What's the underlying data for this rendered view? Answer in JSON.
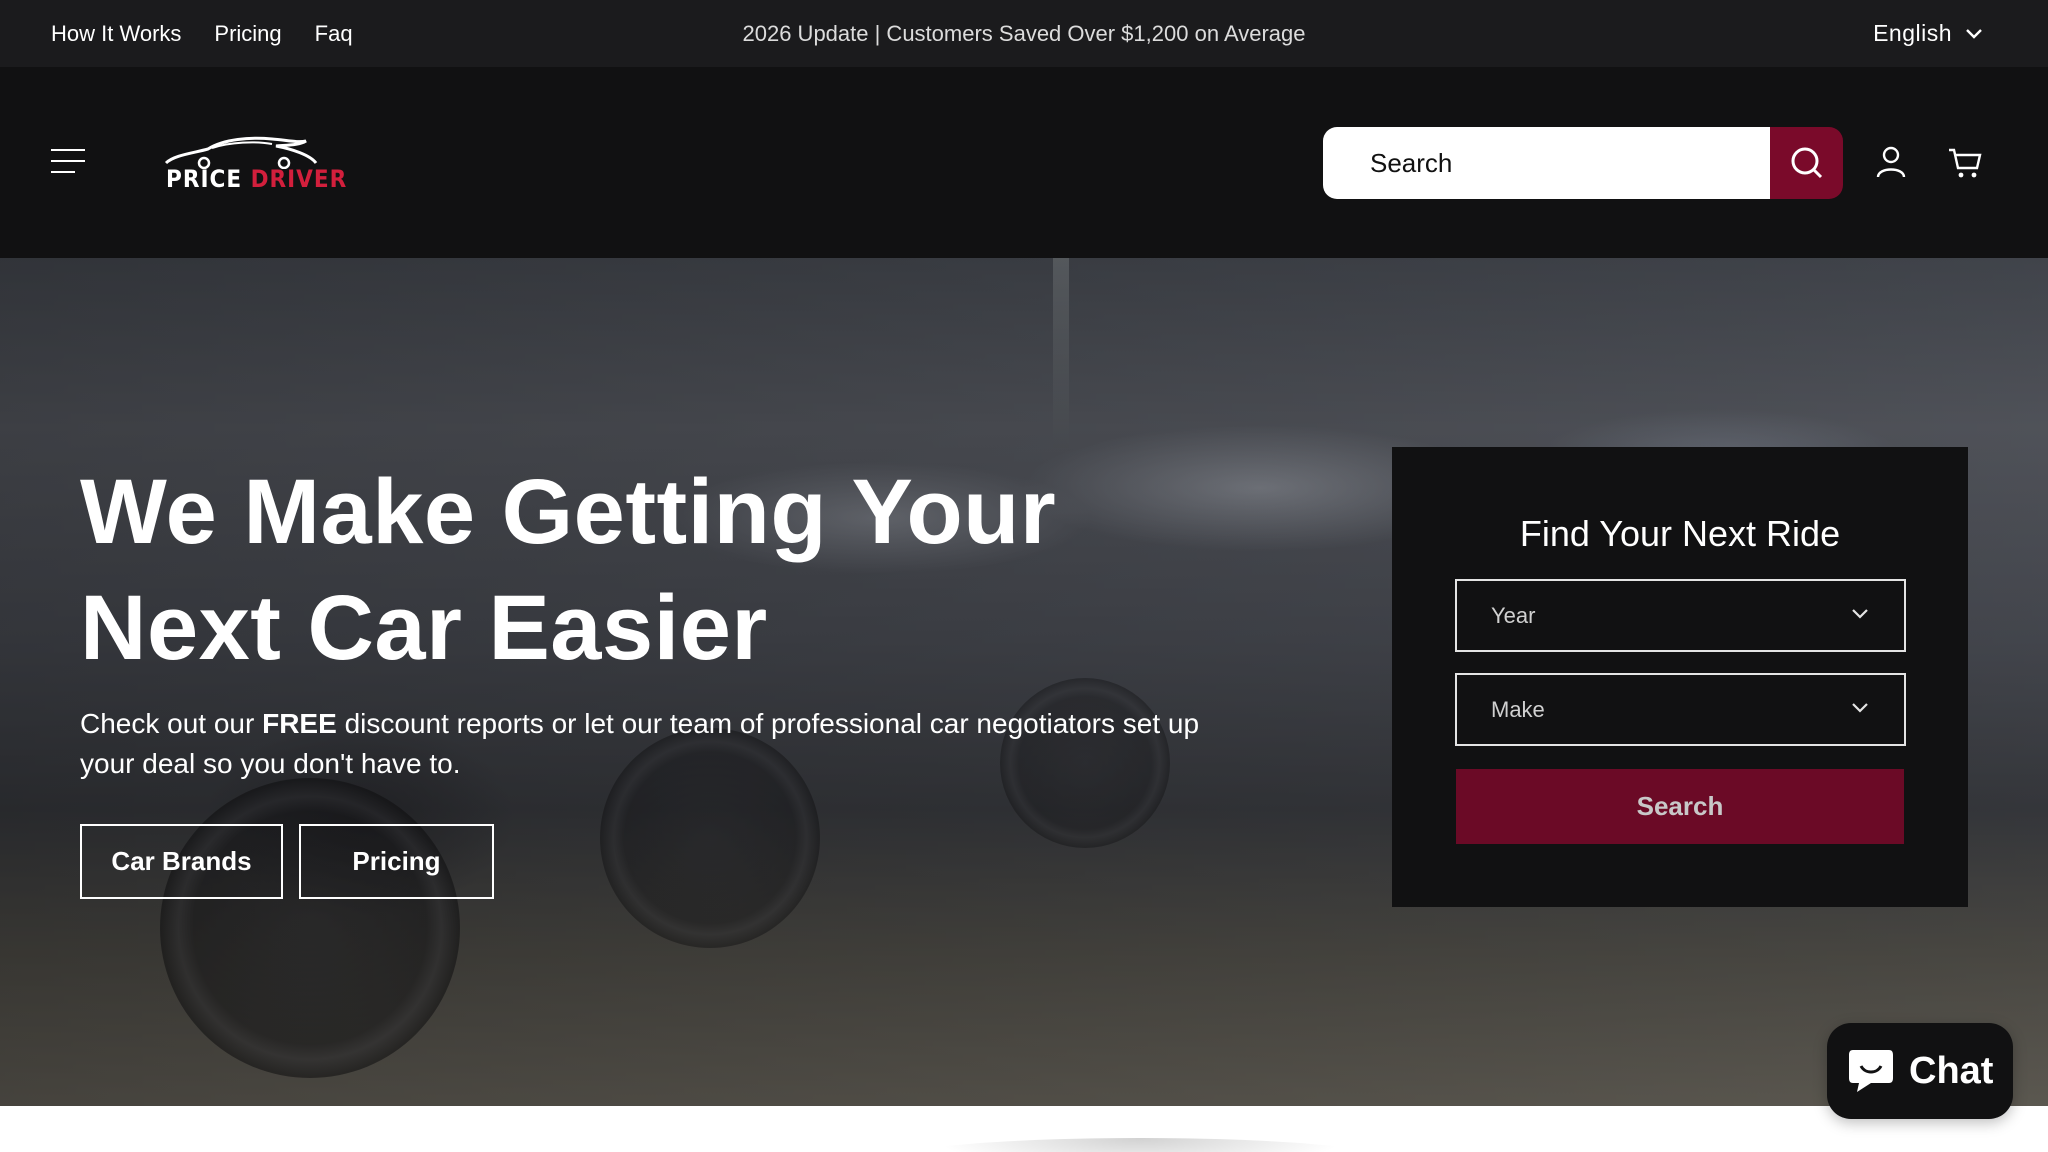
{
  "topbar": {
    "links": [
      "How It Works",
      "Pricing",
      "Faq"
    ],
    "announcement": "2026 Update | Customers Saved Over $1,200 on Average",
    "language": "English"
  },
  "header": {
    "logo": {
      "word1": "PRICE",
      "word2": "DRIVER"
    },
    "search": {
      "placeholder": "Search"
    },
    "icons": [
      "menu-icon",
      "search-icon",
      "account-icon",
      "cart-icon"
    ]
  },
  "hero": {
    "title_line1": "We Make Getting Your",
    "title_line2": "Next Car Easier",
    "subtitle_pre": "Check out our ",
    "subtitle_bold": "FREE",
    "subtitle_post": " discount reports or let our team of professional car negotiators set up your deal so you don't have to.",
    "buttons": {
      "car_brands": "Car Brands",
      "pricing": "Pricing"
    }
  },
  "finder": {
    "title": "Find Your Next Ride",
    "year_value": "Year",
    "make_value": "Make",
    "submit": "Search"
  },
  "chat": {
    "label": "Chat"
  },
  "colors": {
    "accent": "#7a0a2a",
    "logo_red": "#d21f3c",
    "dark": "#111112",
    "topbar": "#1b1b1d"
  }
}
